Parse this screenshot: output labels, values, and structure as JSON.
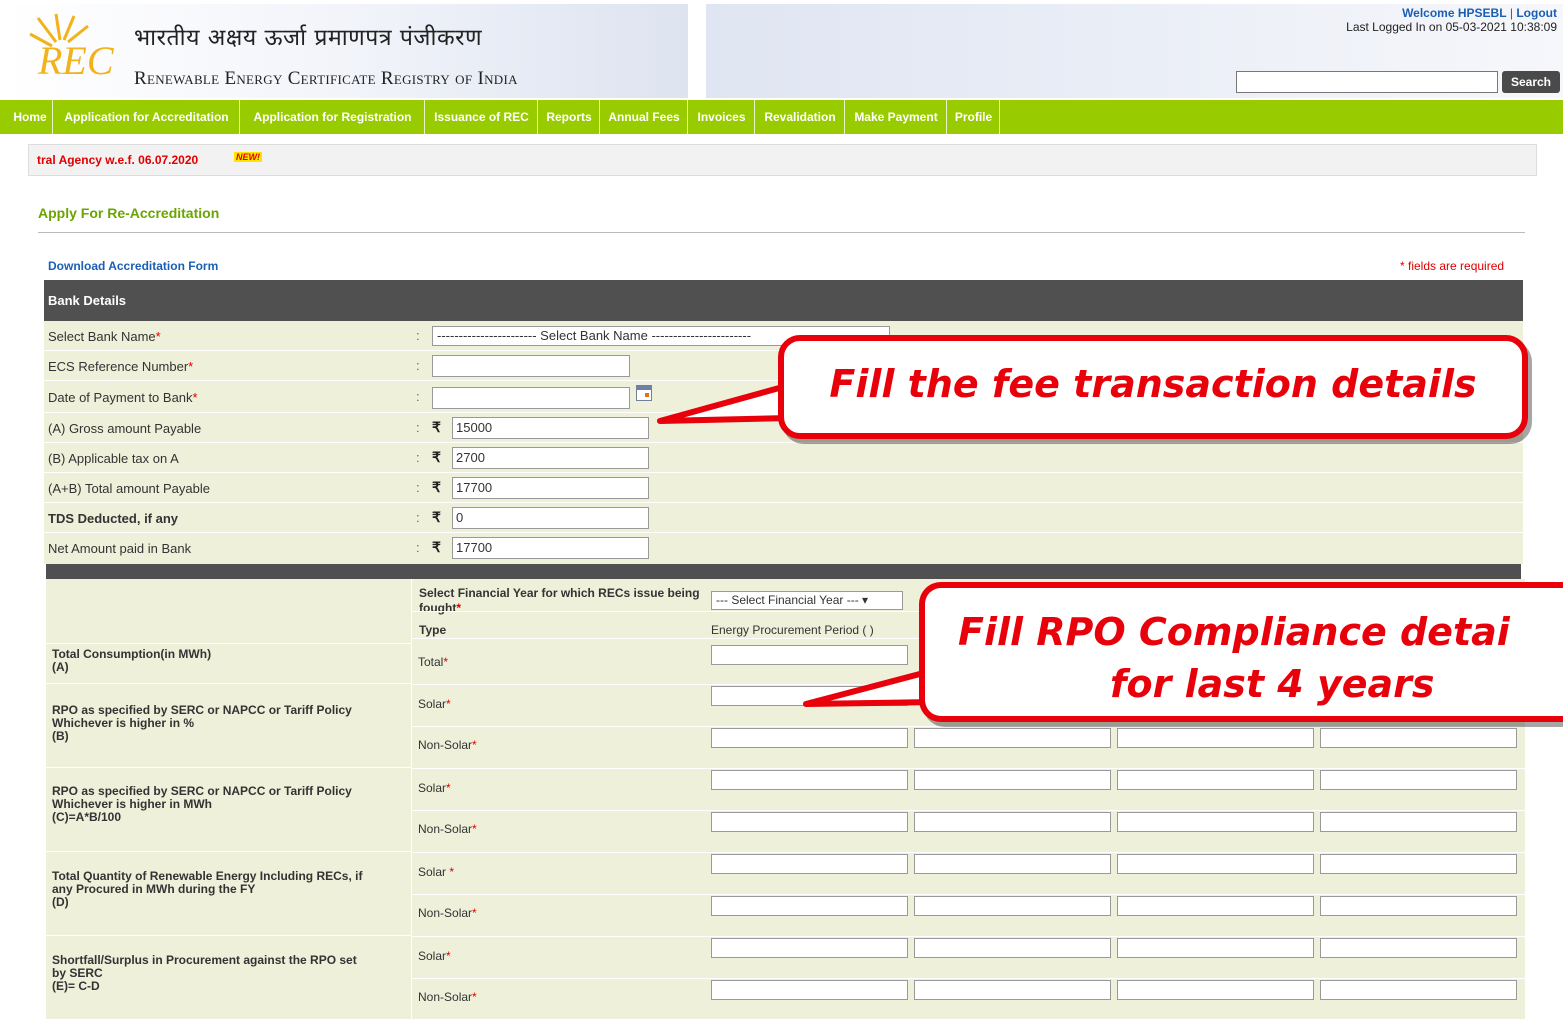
{
  "header": {
    "hindi_title": "भारतीय अक्षय ऊर्जा प्रमाणपत्र पंजीकरण",
    "english_title": "Renewable Energy Certificate Registry of India",
    "welcome_label": "Welcome HPSEBL",
    "logout_label": "Logout",
    "last_logged": "Last Logged In on 05-03-2021 10:38:09",
    "search_placeholder": "",
    "search_button": "Search",
    "logo_icon": "rec-logo-icon"
  },
  "nav": {
    "items": [
      {
        "label": "Home"
      },
      {
        "label": "Application for Accreditation"
      },
      {
        "label": "Application for Registration"
      },
      {
        "label": "Issuance of REC"
      },
      {
        "label": "Reports"
      },
      {
        "label": "Annual Fees"
      },
      {
        "label": "Invoices"
      },
      {
        "label": "Revalidation"
      },
      {
        "label": "Make Payment"
      },
      {
        "label": "Profile"
      }
    ]
  },
  "marquee": {
    "text": "tral Agency w.e.f. 06.07.2020",
    "badge": "NEW!"
  },
  "page": {
    "heading": "Apply For Re-Accreditation",
    "download_link": "Download Accreditation Form",
    "required_note": "* fields are required"
  },
  "bank": {
    "title": "Bank Details",
    "rows": [
      {
        "label": "Select Bank Name",
        "required": "*",
        "value": "----------------------- Select Bank Name -----------------------"
      },
      {
        "label": "ECS Reference Number",
        "required": "*",
        "value": ""
      },
      {
        "label": "Date of Payment to Bank",
        "required": "*",
        "value": ""
      },
      {
        "label": "(A) Gross amount Payable",
        "required": "",
        "value": "15000"
      },
      {
        "label": "(B) Applicable tax on A",
        "required": "",
        "value": "2700"
      },
      {
        "label": "(A+B) Total amount Payable",
        "required": "",
        "value": "17700"
      },
      {
        "label": "TDS Deducted, if any",
        "required": "",
        "value": "0"
      },
      {
        "label": "Net Amount paid in Bank",
        "required": "",
        "value": "17700"
      }
    ],
    "colon": ":",
    "rupee": "₹"
  },
  "rpo": {
    "fy_label": "Select Financial Year for which RECs issue being fought",
    "fy_required": "*",
    "fy_select": "--- Select Financial Year --- ▾",
    "type_label": "Type",
    "period_label": "Energy Procurement Period ( )",
    "sections": [
      {
        "label_lines": [
          "Total Consumption(in MWh)",
          "(A)"
        ],
        "types": [
          {
            "t": "Total",
            "r": "*"
          }
        ]
      },
      {
        "label_lines": [
          "RPO as specified by SERC or NAPCC or Tariff Policy",
          "Whichever is higher in %",
          "(B)"
        ],
        "types": [
          {
            "t": "Solar",
            "r": "*"
          },
          {
            "t": "Non-Solar",
            "r": "*"
          }
        ]
      },
      {
        "label_lines": [
          "RPO as specified by SERC or NAPCC or Tariff Policy",
          "Whichever is higher in MWh",
          "(C)=A*B/100"
        ],
        "types": [
          {
            "t": "Solar",
            "r": "*"
          },
          {
            "t": "Non-Solar",
            "r": "*"
          }
        ]
      },
      {
        "label_lines": [
          "Total Quantity of Renewable Energy Including RECs, if",
          "any Procured in MWh during the FY",
          "(D)"
        ],
        "types": [
          {
            "t": "Solar ",
            "r": "*"
          },
          {
            "t": "Non-Solar",
            "r": "*"
          }
        ]
      },
      {
        "label_lines": [
          "Shortfall/Surplus in Procurement against the RPO set",
          "by SERC",
          "(E)= C-D"
        ],
        "types": [
          {
            "t": "Solar",
            "r": "*"
          },
          {
            "t": "Non-Solar",
            "r": "*"
          }
        ]
      }
    ]
  },
  "callouts": {
    "fee": "Fill the fee transaction details",
    "rpo_line1": "Fill RPO Compliance detai",
    "rpo_line2": "for last 4 years"
  },
  "colors": {
    "nav_green": "#99cc00",
    "heading_green": "#6aa500",
    "section_dark": "#505050",
    "form_bg": "#eef0da",
    "callout_red": "#e8000a"
  }
}
